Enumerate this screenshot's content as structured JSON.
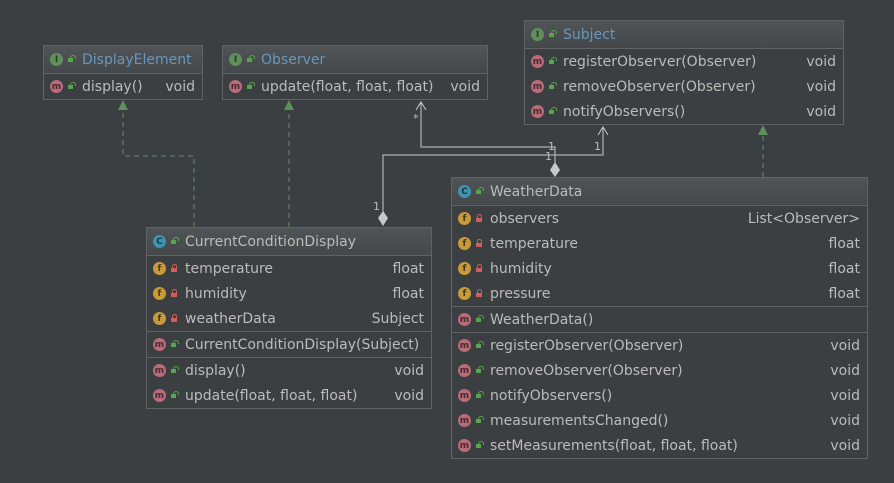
{
  "classes": {
    "display_element": {
      "name": "DisplayElement",
      "kind": "I",
      "methods": [
        {
          "name": "display()",
          "type": "void"
        }
      ]
    },
    "observer": {
      "name": "Observer",
      "kind": "I",
      "methods": [
        {
          "name": "update(float, float, float)",
          "type": "void"
        }
      ]
    },
    "subject": {
      "name": "Subject",
      "kind": "I",
      "methods": [
        {
          "name": "registerObserver(Observer)",
          "type": "void"
        },
        {
          "name": "removeObserver(Observer)",
          "type": "void"
        },
        {
          "name": "notifyObservers()",
          "type": "void"
        }
      ]
    },
    "current_condition_display": {
      "name": "CurrentConditionDisplay",
      "kind": "C",
      "fields": [
        {
          "name": "temperature",
          "type": "float"
        },
        {
          "name": "humidity",
          "type": "float"
        },
        {
          "name": "weatherData",
          "type": "Subject"
        }
      ],
      "constructors": [
        {
          "name": "CurrentConditionDisplay(Subject)",
          "type": ""
        }
      ],
      "methods": [
        {
          "name": "display()",
          "type": "void"
        },
        {
          "name": "update(float, float, float)",
          "type": "void"
        }
      ]
    },
    "weather_data": {
      "name": "WeatherData",
      "kind": "C",
      "fields": [
        {
          "name": "observers",
          "type": "List<Observer>"
        },
        {
          "name": "temperature",
          "type": "float"
        },
        {
          "name": "humidity",
          "type": "float"
        },
        {
          "name": "pressure",
          "type": "float"
        }
      ],
      "constructors": [
        {
          "name": "WeatherData()",
          "type": ""
        }
      ],
      "methods": [
        {
          "name": "registerObserver(Observer)",
          "type": "void"
        },
        {
          "name": "removeObserver(Observer)",
          "type": "void"
        },
        {
          "name": "notifyObservers()",
          "type": "void"
        },
        {
          "name": "measurementsChanged()",
          "type": "void"
        },
        {
          "name": "setMeasurements(float, float, float)",
          "type": "void"
        }
      ]
    }
  },
  "multiplicities": {
    "observers_many": "*",
    "weather_data_to_observer": "1",
    "weather_data_to_subject": "1",
    "ccd_to_subject": "1",
    "ccd_one": "1"
  },
  "colors": {
    "background": "#3c3f41",
    "border": "#5f6365",
    "text": "#bbbbbb",
    "interface_title": "#6897bb",
    "realization_arrow": "#5f8f5a",
    "association_line": "#c8c8c8"
  }
}
